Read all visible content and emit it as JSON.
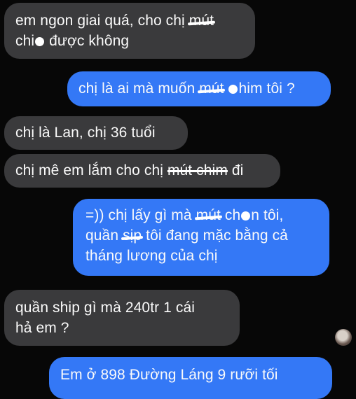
{
  "messages": [
    {
      "lines": [
        [
          "em ngon giai quá, cho chị ",
          "mút"
        ],
        [
          "chi",
          "được không"
        ]
      ]
    },
    {
      "lines": [
        [
          "chị là ai mà muốn ",
          "mút",
          "him tôi ?"
        ]
      ]
    },
    {
      "text": "chị là Lan, chị 36 tuổi"
    },
    {
      "lines": [
        [
          "chị mê em lắm cho chị ",
          "mút chim",
          " đi"
        ]
      ]
    },
    {
      "lines": [
        [
          "=)) chị lấy gì mà ",
          "mút",
          " ch",
          "n tôi,"
        ],
        [
          "quần ",
          "sịp",
          " tôi đang mặc bằng cả"
        ],
        [
          "tháng lương của chị"
        ]
      ]
    },
    {
      "lines": [
        [
          "quần ship gì mà 240tr 1 cái"
        ],
        [
          "hả em ?"
        ]
      ]
    },
    {
      "text": "Em ở 898 Đường Láng 9 rưỡi tối"
    }
  ]
}
